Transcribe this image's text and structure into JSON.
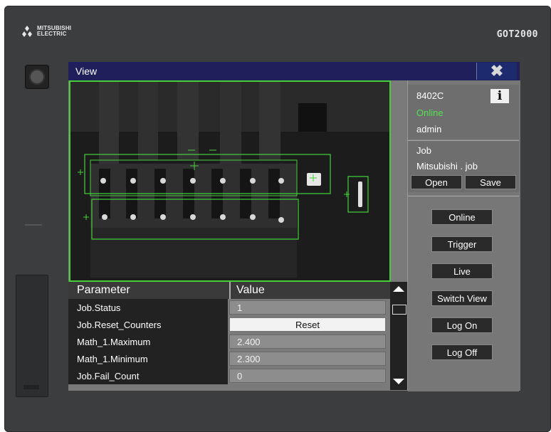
{
  "device": {
    "brand_line1": "MITSUBISHI",
    "brand_line2": "ELECTRIC",
    "model": "GOT2000"
  },
  "window": {
    "title": "View"
  },
  "table": {
    "headers": [
      "Parameter",
      "Value"
    ],
    "rows": [
      {
        "name": "Job.Status",
        "value": "1"
      },
      {
        "name": "Job.Reset_Counters",
        "value": "Reset"
      },
      {
        "name": "Math_1.Maximum",
        "value": "2.400"
      },
      {
        "name": "Math_1.Minimum",
        "value": "2.300"
      },
      {
        "name": "Job.Fail_Count",
        "value": "0"
      }
    ]
  },
  "panel": {
    "device_name": "8402C",
    "status": "Online",
    "user": "admin",
    "job_label": "Job",
    "job_file": "Mitsubishi . job",
    "open_label": "Open",
    "save_label": "Save",
    "buttons": [
      "Online",
      "Trigger",
      "Live",
      "Switch View",
      "Log On",
      "Log Off"
    ]
  },
  "colors": {
    "overlay_green": "#45d03a",
    "title_bar": "#1f1f5c",
    "status_online": "#54e054"
  }
}
